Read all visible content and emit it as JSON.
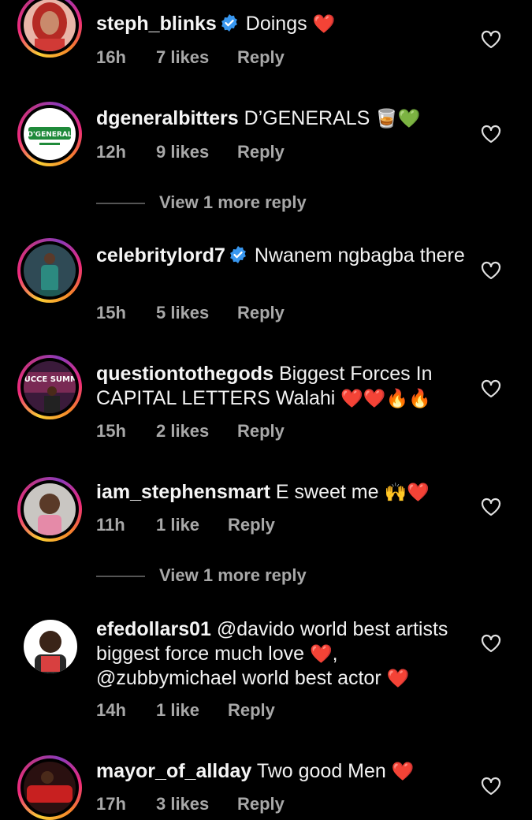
{
  "comments": [
    {
      "username": "steph_blinks",
      "verified": true,
      "text": "Doings",
      "emoji": "❤️",
      "time": "16h",
      "likes": "7 likes",
      "reply": "Reply"
    },
    {
      "username": "dgeneralbitters",
      "verified": false,
      "text": "D’GENERALS",
      "emoji": "🥃💚",
      "time": "12h",
      "likes": "9 likes",
      "reply": "Reply",
      "avatar_text": "D'GENERAL"
    },
    {
      "username": "celebritylord7",
      "verified": true,
      "text": "Nwanem ngbagba there",
      "emoji": "",
      "time": "15h",
      "likes": "5 likes",
      "reply": "Reply"
    },
    {
      "username": "questiontothegods",
      "verified": false,
      "text": "Biggest Forces In CAPITAL LETTERS Walahi",
      "emoji": "❤️❤️🔥🔥",
      "time": "15h",
      "likes": "2 likes",
      "reply": "Reply",
      "avatar_text": "SUCCE SUMMI"
    },
    {
      "username": "iam_stephensmart",
      "verified": false,
      "text": "E sweet me",
      "emoji": "🙌❤️",
      "time": "11h",
      "likes": "1 like",
      "reply": "Reply"
    },
    {
      "username": "efedollars01",
      "verified": false,
      "text": "@davido world best artists biggest force much love",
      "text2": ", @zubbymichael world best actor",
      "emoji": "❤️",
      "time": "14h",
      "likes": "1 like",
      "reply": "Reply"
    },
    {
      "username": "mayor_of_allday",
      "verified": false,
      "text": "Two good Men",
      "emoji": "❤️",
      "time": "17h",
      "likes": "3 likes",
      "reply": "Reply"
    }
  ],
  "view_more_1": "View 1 more reply",
  "view_more_2": "View 1 more reply",
  "colors": {
    "background": "#000000",
    "text": "#f5f5f5",
    "meta": "#a8a8a8",
    "verified": "#3897f0",
    "heart_red": "#e0245e"
  },
  "icons": {
    "like": "heart-outline-icon",
    "verified": "verified-badge-icon"
  }
}
